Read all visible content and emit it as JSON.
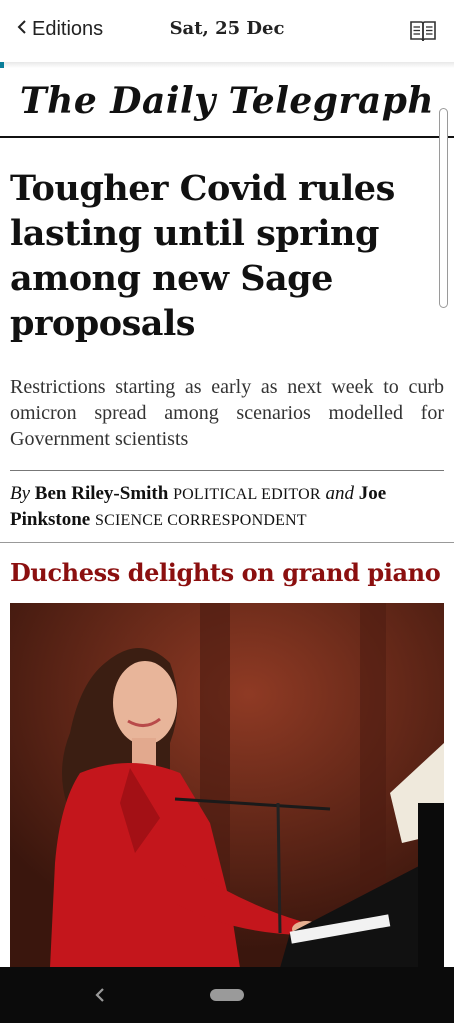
{
  "topbar": {
    "back_label": "Editions",
    "date": "Sat, 25 Dec",
    "book_icon": "open-book-icon"
  },
  "masthead": {
    "title": "The Daily Telegraph"
  },
  "article": {
    "headline": "Tougher Covid rules lasting until spring among new Sage proposals",
    "standfirst": "Restrictions starting as early as next week to curb omicron spread among scenarios modelled for Government scientists",
    "byline": {
      "by": "By",
      "author1": "Ben Riley-Smith",
      "role1": "POLITICAL EDITOR",
      "and": "and",
      "author2": "Joe Pinkstone",
      "role2": "SCIENCE CORRESPONDENT"
    }
  },
  "feature": {
    "kicker": "Duchess delights on grand piano"
  },
  "colors": {
    "kicker": "#8b0f0f",
    "accent": "#0a7e9a"
  }
}
